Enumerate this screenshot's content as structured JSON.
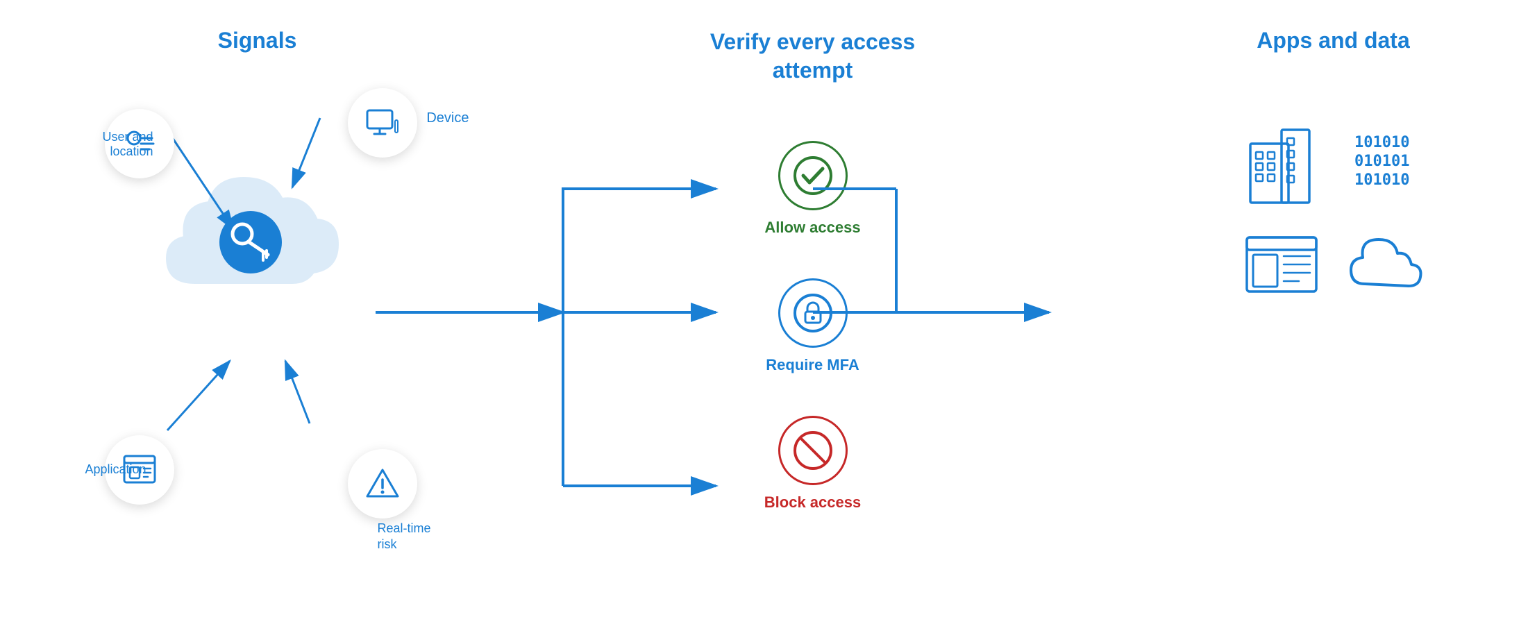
{
  "sections": {
    "signals": {
      "title": "Signals",
      "items": [
        {
          "id": "user",
          "label": "User and\nlocation"
        },
        {
          "id": "device",
          "label": "Device"
        },
        {
          "id": "application",
          "label": "Application"
        },
        {
          "id": "risk",
          "label": "Real-time\nrisk"
        }
      ]
    },
    "verify": {
      "title": "Verify every access\nattempt",
      "items": [
        {
          "id": "allow",
          "label": "Allow access",
          "color": "green"
        },
        {
          "id": "mfa",
          "label": "Require MFA",
          "color": "blue"
        },
        {
          "id": "block",
          "label": "Block access",
          "color": "red"
        }
      ]
    },
    "apps": {
      "title": "Apps and data",
      "items": [
        {
          "id": "building",
          "label": "Office building"
        },
        {
          "id": "data",
          "label": "Binary data"
        },
        {
          "id": "app",
          "label": "Application"
        },
        {
          "id": "cloud",
          "label": "Cloud"
        }
      ]
    }
  },
  "colors": {
    "blue": "#1a7fd4",
    "green": "#2e7d32",
    "red": "#c62828",
    "white": "#ffffff",
    "shadow": "rgba(0,0,0,0.12)"
  }
}
